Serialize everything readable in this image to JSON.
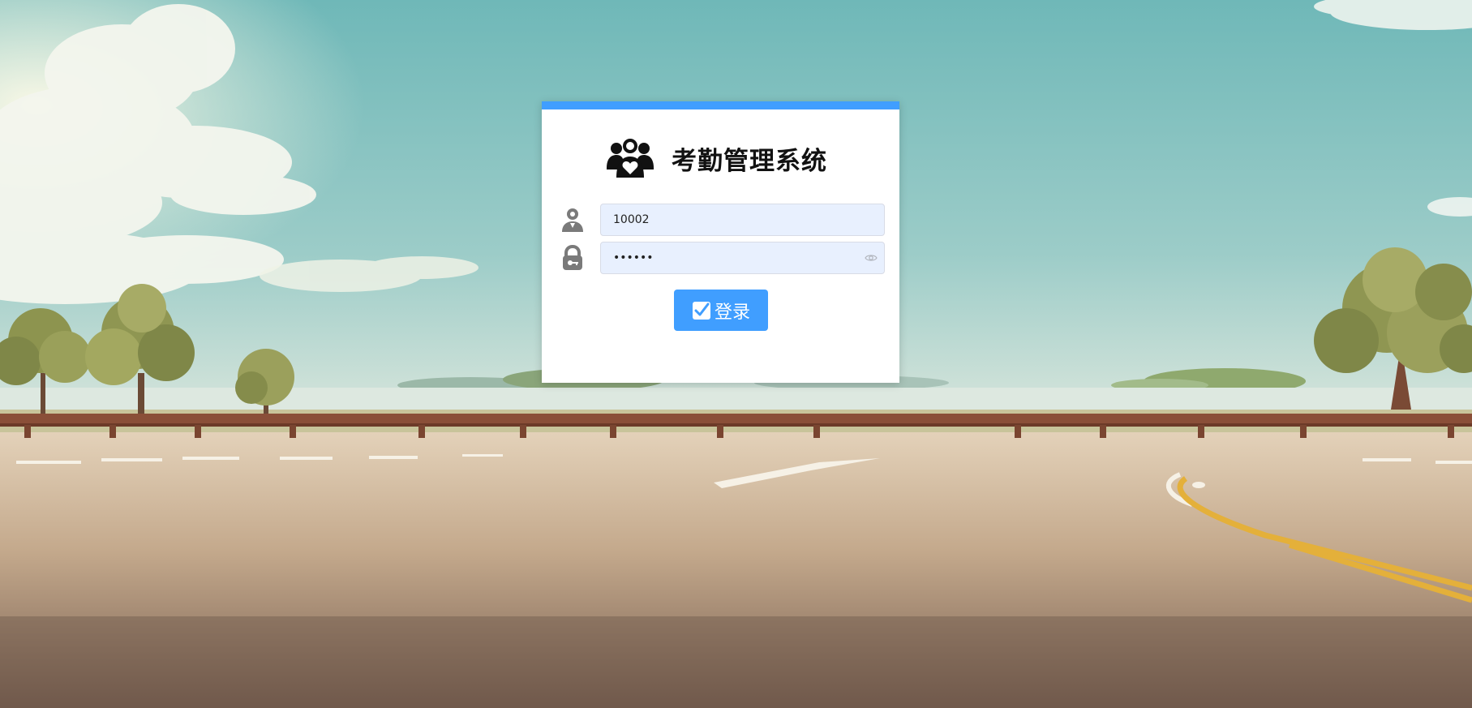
{
  "app": {
    "title": "考勤管理系统",
    "logo_icon": "people-heart-icon"
  },
  "login_form": {
    "username": {
      "icon": "user-icon",
      "value": "10002"
    },
    "password": {
      "icon": "lock-icon",
      "value": "123456",
      "toggle_icon": "eye-icon"
    },
    "submit": {
      "icon": "check-square-icon",
      "label": "登录"
    }
  },
  "colors": {
    "accent": "#409eff",
    "input_background": "#e8f0fe",
    "sky": "#7fc0c0",
    "road": "#c9b39a"
  }
}
